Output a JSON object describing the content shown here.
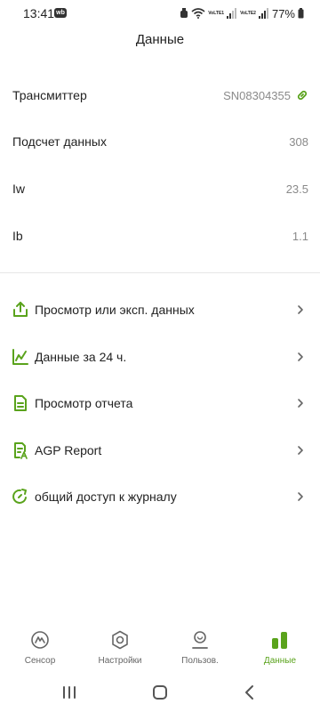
{
  "status_bar": {
    "time": "13:41",
    "app_badge": "wb",
    "volte1": "VoLTE1",
    "volte2": "VoLTE2",
    "battery": "77%"
  },
  "header": {
    "title": "Данные"
  },
  "info": [
    {
      "label": "Трансмиттер",
      "value": "SN08304355"
    },
    {
      "label": "Подсчет данных",
      "value": "308"
    },
    {
      "label": "Iw",
      "value": "23.5"
    },
    {
      "label": "Ib",
      "value": "1.1"
    }
  ],
  "menu": [
    {
      "label": "Просмотр или эксп. данных",
      "icon": "export-icon"
    },
    {
      "label": "Данные за 24 ч.",
      "icon": "line-chart-icon"
    },
    {
      "label": "Просмотр отчета",
      "icon": "report-icon"
    },
    {
      "label": "AGP Report",
      "icon": "agp-report-icon"
    },
    {
      "label": "общий доступ к журналу",
      "icon": "share-log-icon"
    }
  ],
  "tabs": [
    {
      "label": "Сенсор",
      "icon": "sensor-icon",
      "active": false
    },
    {
      "label": "Настройки",
      "icon": "settings-icon",
      "active": false
    },
    {
      "label": "Пользов.",
      "icon": "user-icon",
      "active": false
    },
    {
      "label": "Данные",
      "icon": "data-icon",
      "active": true
    }
  ],
  "colors": {
    "accent": "#5aa31c",
    "text": "#222222",
    "muted": "#8a8a8a",
    "divider": "#e6e6e6"
  }
}
